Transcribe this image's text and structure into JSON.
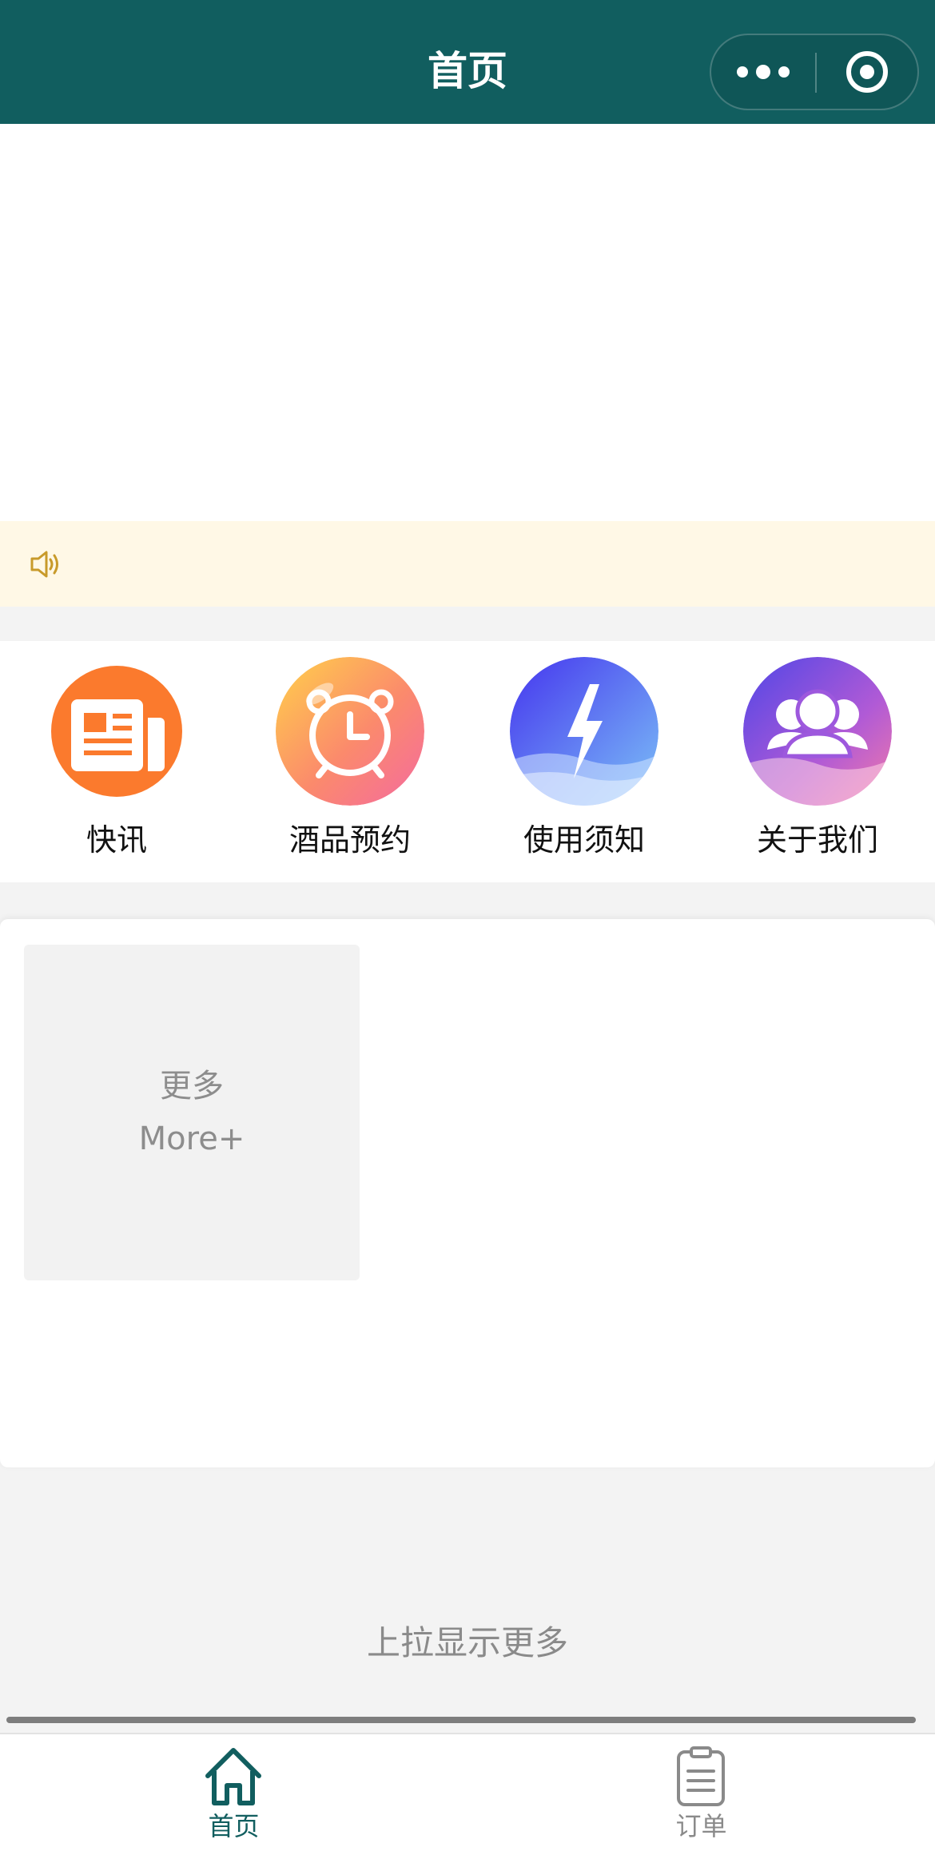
{
  "navbar": {
    "title": "首页",
    "background": "#115e5f",
    "capsule": {
      "more_icon": "more-dots-icon",
      "close_icon": "target-close-icon"
    }
  },
  "notice": {
    "icon": "speaker-icon",
    "background": "#fff8e6",
    "text": ""
  },
  "quick_nav": [
    {
      "label": "快讯",
      "icon": "newspaper-icon"
    },
    {
      "label": "酒品预约",
      "icon": "alarm-clock-icon"
    },
    {
      "label": "使用须知",
      "icon": "lightning-icon"
    },
    {
      "label": "关于我们",
      "icon": "users-icon"
    }
  ],
  "products": {
    "more_tile": {
      "label_cn": "更多",
      "label_en": "More+"
    }
  },
  "load_more": "上拉显示更多",
  "tabbar": {
    "active_color": "#115e5f",
    "inactive_color": "#8a8a8a",
    "tabs": [
      {
        "label": "首页",
        "icon": "home-icon",
        "active": true
      },
      {
        "label": "订单",
        "icon": "clipboard-icon",
        "active": false
      }
    ]
  }
}
